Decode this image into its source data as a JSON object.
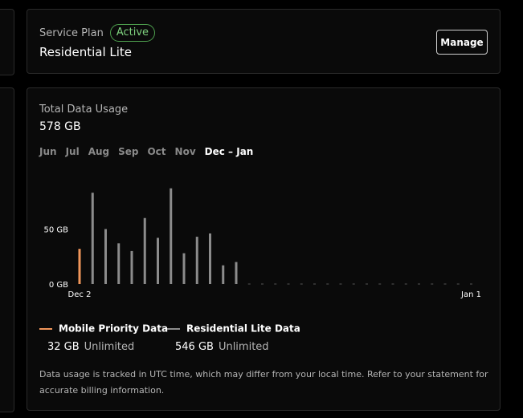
{
  "service_plan": {
    "label": "Service Plan",
    "status": "Active",
    "name": "Residential Lite",
    "manage_label": "Manage"
  },
  "usage": {
    "title": "Total Data Usage",
    "total": "578 GB",
    "tabs": [
      {
        "label": "Jun",
        "active": false
      },
      {
        "label": "Jul",
        "active": false
      },
      {
        "label": "Aug",
        "active": false
      },
      {
        "label": "Sep",
        "active": false
      },
      {
        "label": "Oct",
        "active": false
      },
      {
        "label": "Nov",
        "active": false
      },
      {
        "label": "Dec – Jan",
        "active": true
      }
    ],
    "legend": [
      {
        "name": "Mobile Priority Data",
        "amount": "32 GB",
        "limit": "Unlimited",
        "color": "#f0955a"
      },
      {
        "name": "Residential Lite Data",
        "amount": "546 GB",
        "limit": "Unlimited",
        "color": "#8c8c8c"
      }
    ],
    "footnote": "Data usage is tracked in UTC time, which may differ from your local time. Refer to your statement for accurate billing information."
  },
  "chart_data": {
    "type": "bar",
    "yticks": [
      {
        "value": 0,
        "label": "0 GB"
      },
      {
        "value": 50,
        "label": "50 GB"
      }
    ],
    "ylim": [
      0,
      100
    ],
    "xtick_labels": [
      {
        "index": 0,
        "label": "Dec 2"
      },
      {
        "index": 30,
        "label": "Jan 1"
      }
    ],
    "series": [
      {
        "name": "Mobile Priority Data",
        "color": "#f0955a",
        "values": [
          32,
          null,
          null,
          null,
          null,
          null,
          null,
          null,
          null,
          null,
          null,
          null,
          null,
          null,
          null,
          null,
          null,
          null,
          null,
          null,
          null,
          null,
          null,
          null,
          null,
          null,
          null,
          null,
          null,
          null,
          null
        ]
      },
      {
        "name": "Residential Lite Data",
        "color": "#8c8c8c",
        "values": [
          null,
          83,
          50,
          37,
          30,
          60,
          42,
          87,
          28,
          43,
          46,
          17,
          20,
          0,
          0,
          0,
          0,
          0,
          0,
          0,
          0,
          0,
          0,
          0,
          0,
          0,
          0,
          0,
          0,
          0,
          0
        ]
      }
    ]
  }
}
